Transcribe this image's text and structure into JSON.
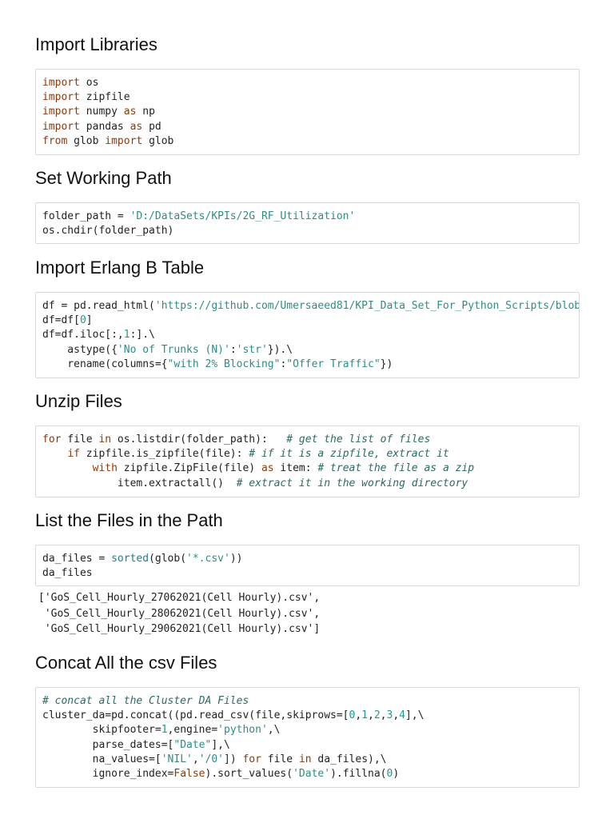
{
  "colors": {
    "keyword": "#8b3a0e",
    "string": "#2e8c84",
    "number": "#1e9a8a",
    "comment": "#2b6a63",
    "builtin": "#1f7a9c",
    "text": "#1f1f1f",
    "cell_border": "#d9d9d9"
  },
  "sections": [
    {
      "heading": "Import Libraries",
      "code": [
        [
          [
            "kw",
            "import"
          ],
          [
            "p",
            " os"
          ]
        ],
        [
          [
            "kw",
            "import"
          ],
          [
            "p",
            " zipfile"
          ]
        ],
        [
          [
            "kw",
            "import"
          ],
          [
            "p",
            " numpy "
          ],
          [
            "kw",
            "as"
          ],
          [
            "p",
            " np"
          ]
        ],
        [
          [
            "kw",
            "import"
          ],
          [
            "p",
            " pandas "
          ],
          [
            "kw",
            "as"
          ],
          [
            "p",
            " pd"
          ]
        ],
        [
          [
            "kw",
            "from"
          ],
          [
            "p",
            " glob "
          ],
          [
            "kw",
            "import"
          ],
          [
            "p",
            " glob"
          ]
        ]
      ]
    },
    {
      "heading": "Set Working Path",
      "code": [
        [
          [
            "p",
            "folder_path = "
          ],
          [
            "str",
            "'D:/DataSets/KPIs/2G_RF_Utilization'"
          ]
        ],
        [
          [
            "p",
            "os.chdir(folder_path)"
          ]
        ]
      ]
    },
    {
      "heading": "Import Erlang B Table",
      "code": [
        [
          [
            "p",
            "df = pd.read_html("
          ],
          [
            "str",
            "'https://github.com/Umersaeed81/KPI_Data_Set_For_Python_Scripts/blob/"
          ]
        ],
        [
          [
            "p",
            "df=df["
          ],
          [
            "num",
            "0"
          ],
          [
            "p",
            "]"
          ]
        ],
        [
          [
            "p",
            "df=df.iloc[:,"
          ],
          [
            "num",
            "1"
          ],
          [
            "p",
            ":].\\"
          ]
        ],
        [
          [
            "p",
            "    astype({"
          ],
          [
            "str",
            "'No of Trunks (N)'"
          ],
          [
            "p",
            ":"
          ],
          [
            "str",
            "'str'"
          ],
          [
            "p",
            "}).\\"
          ]
        ],
        [
          [
            "p",
            "    rename(columns={"
          ],
          [
            "str",
            "\"with 2% Blocking\""
          ],
          [
            "p",
            ":"
          ],
          [
            "str",
            "\"Offer Traffic\""
          ],
          [
            "p",
            "})"
          ]
        ]
      ]
    },
    {
      "heading": "Unzip Files",
      "code": [
        [
          [
            "kw",
            "for"
          ],
          [
            "p",
            " file "
          ],
          [
            "kw",
            "in"
          ],
          [
            "p",
            " os.listdir(folder_path):   "
          ],
          [
            "com",
            "# get the list of files"
          ]
        ],
        [
          [
            "p",
            "    "
          ],
          [
            "kw",
            "if"
          ],
          [
            "p",
            " zipfile.is_zipfile(file): "
          ],
          [
            "com",
            "# if it is a zipfile, extract it"
          ]
        ],
        [
          [
            "p",
            "        "
          ],
          [
            "kw",
            "with"
          ],
          [
            "p",
            " zipfile.ZipFile(file) "
          ],
          [
            "kw",
            "as"
          ],
          [
            "p",
            " item: "
          ],
          [
            "com",
            "# treat the file as a zip"
          ]
        ],
        [
          [
            "p",
            "            item.extractall()  "
          ],
          [
            "com",
            "# extract it in the working directory"
          ]
        ]
      ]
    },
    {
      "heading": "List the Files in the Path",
      "code": [
        [
          [
            "p",
            "da_files = "
          ],
          [
            "bi",
            "sorted"
          ],
          [
            "p",
            "(glob("
          ],
          [
            "str",
            "'*.csv'"
          ],
          [
            "p",
            "))"
          ]
        ],
        [
          [
            "p",
            "da_files"
          ]
        ]
      ],
      "output": [
        "['GoS_Cell_Hourly_27062021(Cell Hourly).csv',",
        " 'GoS_Cell_Hourly_28062021(Cell Hourly).csv',",
        " 'GoS_Cell_Hourly_29062021(Cell Hourly).csv']"
      ]
    },
    {
      "heading": "Concat All the csv Files",
      "code": [
        [
          [
            "com",
            "# concat all the Cluster DA Files"
          ]
        ],
        [
          [
            "p",
            "cluster_da=pd.concat((pd.read_csv(file,skiprows=["
          ],
          [
            "num",
            "0"
          ],
          [
            "p",
            ","
          ],
          [
            "num",
            "1"
          ],
          [
            "p",
            ","
          ],
          [
            "num",
            "2"
          ],
          [
            "p",
            ","
          ],
          [
            "num",
            "3"
          ],
          [
            "p",
            ","
          ],
          [
            "num",
            "4"
          ],
          [
            "p",
            "],\\"
          ]
        ],
        [
          [
            "p",
            "        skipfooter="
          ],
          [
            "num",
            "1"
          ],
          [
            "p",
            ",engine="
          ],
          [
            "str",
            "'python'"
          ],
          [
            "p",
            ",\\"
          ]
        ],
        [
          [
            "p",
            "        parse_dates=["
          ],
          [
            "str",
            "\"Date\""
          ],
          [
            "p",
            "],\\"
          ]
        ],
        [
          [
            "p",
            "        na_values=["
          ],
          [
            "str",
            "'NIL'"
          ],
          [
            "p",
            ","
          ],
          [
            "str",
            "'/0'"
          ],
          [
            "p",
            "]) "
          ],
          [
            "kw",
            "for"
          ],
          [
            "p",
            " file "
          ],
          [
            "kw",
            "in"
          ],
          [
            "p",
            " da_files),\\"
          ]
        ],
        [
          [
            "p",
            "        ignore_index="
          ],
          [
            "kw",
            "False"
          ],
          [
            "p",
            ").sort_values("
          ],
          [
            "str",
            "'Date'"
          ],
          [
            "p",
            ").fillna("
          ],
          [
            "num",
            "0"
          ],
          [
            "p",
            ")"
          ]
        ]
      ]
    }
  ]
}
